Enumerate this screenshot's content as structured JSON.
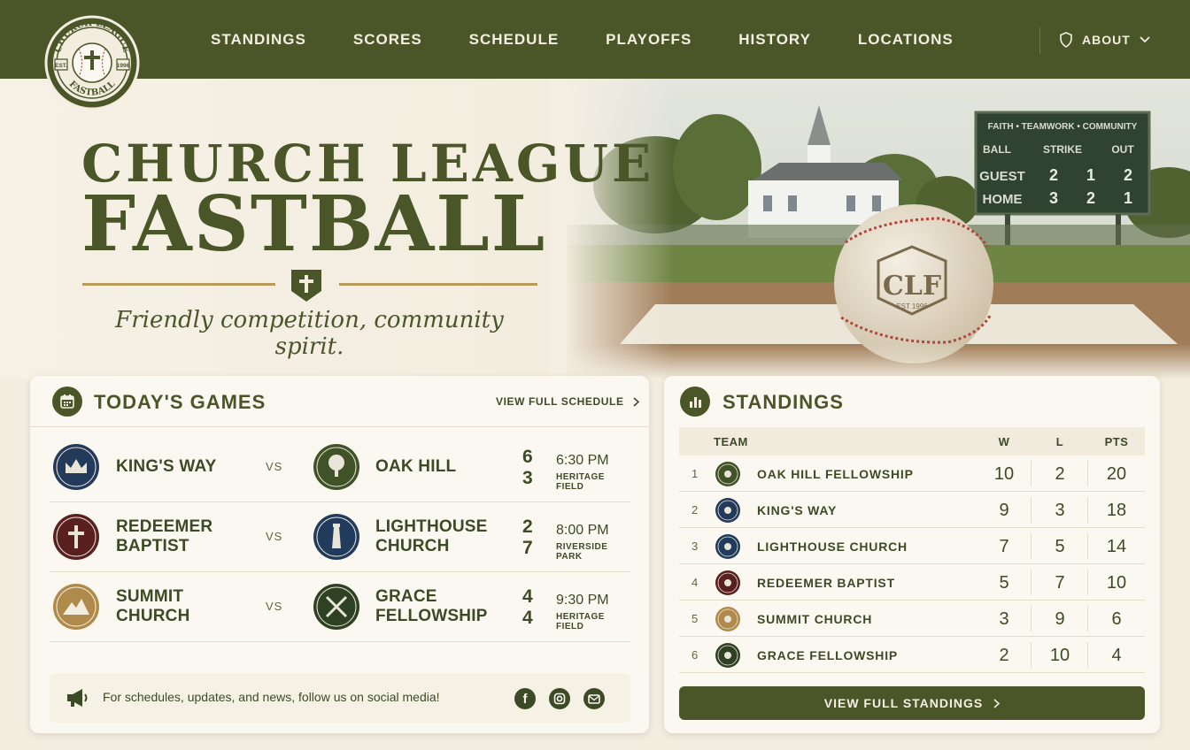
{
  "nav": {
    "items": [
      "STANDINGS",
      "SCORES",
      "SCHEDULE",
      "PLAYOFFS",
      "HISTORY",
      "LOCATIONS"
    ],
    "about": "ABOUT"
  },
  "logo": {
    "top": "CHURCH LEAGUE",
    "bottom": "FASTBALL",
    "est": "EST.",
    "year": "1996"
  },
  "hero": {
    "title_1": "CHURCH LEAGUE",
    "title_2": "FASTBALL",
    "tagline": "Friendly competition, community spirit.",
    "scoreboard": {
      "header": "FAITH • TEAMWORK • COMMUNITY",
      "cols": [
        "BALL",
        "STRIKE",
        "OUT"
      ],
      "rows": [
        {
          "label": "GUEST",
          "vals": [
            "2",
            "1",
            "2"
          ]
        },
        {
          "label": "HOME",
          "vals": [
            "3",
            "2",
            "1"
          ]
        }
      ]
    },
    "ball_mark": "CLF",
    "ball_sub": "EST 1996"
  },
  "games": {
    "title": "TODAY'S GAMES",
    "view_schedule": "VIEW FULL SCHEDULE",
    "vs": "VS",
    "rows": [
      {
        "home": [
          "KING'S WAY"
        ],
        "away": [
          "OAK HILL"
        ],
        "home_score": "6",
        "away_score": "3",
        "time": "6:30 PM",
        "field": "HERITAGE FIELD",
        "home_badge": "kings-way",
        "away_badge": "oak-hill"
      },
      {
        "home": [
          "REDEEMER",
          "BAPTIST"
        ],
        "away": [
          "LIGHTHOUSE",
          "CHURCH"
        ],
        "home_score": "2",
        "away_score": "7",
        "time": "8:00 PM",
        "field": "RIVERSIDE PARK",
        "home_badge": "redeemer",
        "away_badge": "lighthouse"
      },
      {
        "home": [
          "SUMMIT",
          "CHURCH"
        ],
        "away": [
          "GRACE",
          "FELLOWSHIP"
        ],
        "home_score": "4",
        "away_score": "4",
        "time": "9:30 PM",
        "field": "HERITAGE FIELD",
        "home_badge": "summit",
        "away_badge": "grace"
      }
    ],
    "social_text": "For schedules, updates, and news, follow us on social media!"
  },
  "standings": {
    "title": "STANDINGS",
    "headers": {
      "team": "TEAM",
      "w": "W",
      "l": "L",
      "pts": "PTS"
    },
    "rows": [
      {
        "rank": "1",
        "team": "OAK HILL FELLOWSHIP",
        "w": "10",
        "l": "2",
        "pts": "20",
        "badge": "oak-hill"
      },
      {
        "rank": "2",
        "team": "KING'S WAY",
        "w": "9",
        "l": "3",
        "pts": "18",
        "badge": "kings-way"
      },
      {
        "rank": "3",
        "team": "LIGHTHOUSE CHURCH",
        "w": "7",
        "l": "5",
        "pts": "14",
        "badge": "lighthouse"
      },
      {
        "rank": "4",
        "team": "REDEEMER BAPTIST",
        "w": "5",
        "l": "7",
        "pts": "10",
        "badge": "redeemer"
      },
      {
        "rank": "5",
        "team": "SUMMIT CHURCH",
        "w": "3",
        "l": "9",
        "pts": "6",
        "badge": "summit"
      },
      {
        "rank": "6",
        "team": "GRACE FELLOWSHIP",
        "w": "2",
        "l": "10",
        "pts": "4",
        "badge": "grace"
      }
    ],
    "button": "VIEW FULL STANDINGS"
  },
  "colors": {
    "brand_green": "#4a5628",
    "cream": "#f3ede0",
    "gold": "#b99a5b",
    "kings_way": "#233a5a",
    "oak_hill": "#3f5228",
    "redeemer": "#5a1f1f",
    "lighthouse": "#213b5c",
    "summit": "#b08a4a",
    "grace": "#2f4123"
  }
}
